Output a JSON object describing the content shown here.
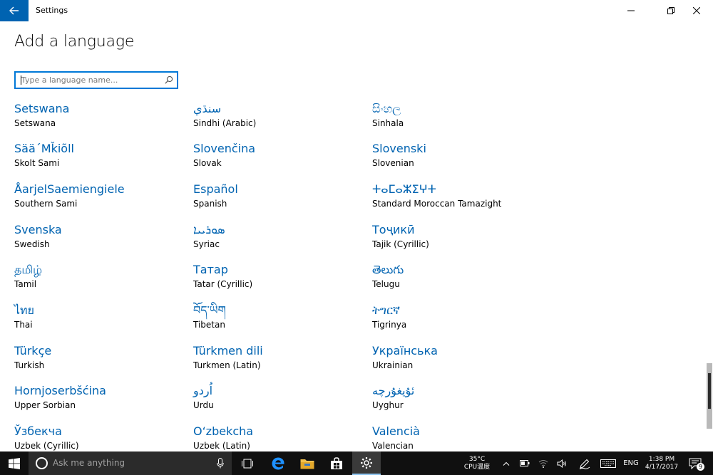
{
  "window": {
    "title": "Settings"
  },
  "page": {
    "title": "Add a language"
  },
  "search": {
    "placeholder": "Type a language name..."
  },
  "languages": [
    {
      "native": "Setswana",
      "english": "Setswana"
    },
    {
      "native": "سنڌي",
      "english": "Sindhi (Arabic)"
    },
    {
      "native": "සිංහල",
      "english": "Sinhala"
    },
    {
      "native": "Sää´Mǩiõll",
      "english": "Skolt Sami"
    },
    {
      "native": "Slovenčina",
      "english": "Slovak"
    },
    {
      "native": "Slovenski",
      "english": "Slovenian"
    },
    {
      "native": "ÅarjelSaemiengiele",
      "english": "Southern Sami"
    },
    {
      "native": "Español",
      "english": "Spanish"
    },
    {
      "native": "ⵜⴰⵎⴰⵣⵉⵖⵜ",
      "english": "Standard Moroccan Tamazight"
    },
    {
      "native": "Svenska",
      "english": "Swedish"
    },
    {
      "native": "ܣܘܪܝܝܐ",
      "english": "Syriac"
    },
    {
      "native": "Тоҷикӣ",
      "english": "Tajik (Cyrillic)"
    },
    {
      "native": "தமிழ்",
      "english": "Tamil"
    },
    {
      "native": "Татар",
      "english": "Tatar (Cyrillic)"
    },
    {
      "native": "తెలుగు",
      "english": "Telugu"
    },
    {
      "native": "ไทย",
      "english": "Thai"
    },
    {
      "native": "བོད་ཡིག",
      "english": "Tibetan"
    },
    {
      "native": "ትግርኛ",
      "english": "Tigrinya"
    },
    {
      "native": "Türkçe",
      "english": "Turkish"
    },
    {
      "native": "Türkmen dili",
      "english": "Turkmen (Latin)"
    },
    {
      "native": "Українська",
      "english": "Ukrainian"
    },
    {
      "native": "Hornjoserbšćina",
      "english": "Upper Sorbian"
    },
    {
      "native": "اُردو",
      "english": "Urdu"
    },
    {
      "native": "ئۇيغۇرچە",
      "english": "Uyghur"
    },
    {
      "native": "Ўзбекча",
      "english": "Uzbek (Cyrillic)"
    },
    {
      "native": "O‘zbekcha",
      "english": "Uzbek (Latin)"
    },
    {
      "native": "Valencià",
      "english": "Valencian"
    }
  ],
  "taskbar": {
    "search_placeholder": "Ask me anything",
    "temperature": "35°C",
    "cpu_label": "CPU温度",
    "input_lang": "ENG",
    "time": "1:38 PM",
    "date": "4/17/2017",
    "notification_count": "9"
  },
  "colors": {
    "accent": "#0063b1",
    "focus_border": "#0078d7",
    "taskbar": "#101010"
  }
}
